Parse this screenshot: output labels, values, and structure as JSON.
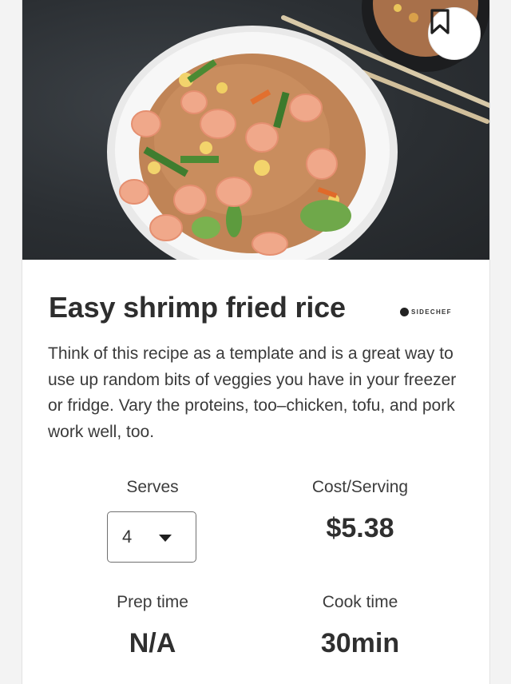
{
  "recipe": {
    "title": "Easy shrimp fried rice",
    "brand": "SIDECHEF",
    "description": "Think of this recipe as a template and is a great way to use up random bits of veggies you have in your freezer or fridge. Vary the proteins, too–chicken, tofu, and pork work well, too."
  },
  "stats": {
    "serves_label": "Serves",
    "serves_value": "4",
    "cost_label": "Cost/Serving",
    "cost_value": "$5.38",
    "prep_label": "Prep time",
    "prep_value": "N/A",
    "cook_label": "Cook time",
    "cook_value": "30min"
  },
  "icons": {
    "bookmark": "bookmark-icon",
    "dropdown": "caret-down-icon",
    "brand_logo": "sidechef-logo-icon"
  },
  "colors": {
    "text": "#2e2e2e",
    "card_bg": "#ffffff",
    "photo_bg": "#2b2f33"
  }
}
